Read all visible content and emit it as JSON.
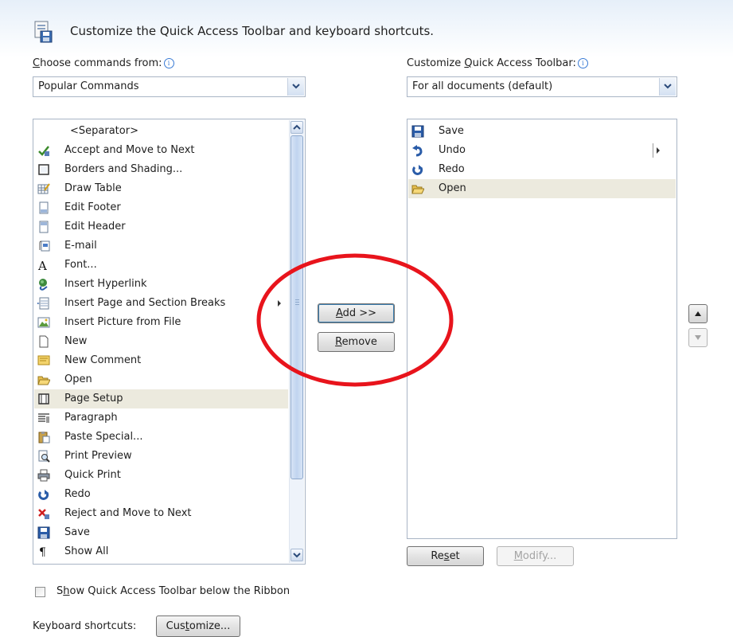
{
  "header": {
    "title": "Customize the Quick Access Toolbar and keyboard shortcuts."
  },
  "left": {
    "label_pre": "",
    "label_accel": "C",
    "label_post": "hoose commands from:",
    "dropdown_value": "Popular Commands",
    "items": [
      {
        "label": "<Separator>",
        "icon": "none"
      },
      {
        "label": "Accept and Move to Next",
        "icon": "accept-icon"
      },
      {
        "label": "Borders and Shading...",
        "icon": "borders-icon"
      },
      {
        "label": "Draw Table",
        "icon": "draw-table-icon"
      },
      {
        "label": "Edit Footer",
        "icon": "footer-icon"
      },
      {
        "label": "Edit Header",
        "icon": "header-icon"
      },
      {
        "label": "E-mail",
        "icon": "email-icon"
      },
      {
        "label": "Font...",
        "icon": "font-icon"
      },
      {
        "label": "Insert Hyperlink",
        "icon": "hyperlink-icon"
      },
      {
        "label": "Insert Page and Section Breaks",
        "icon": "page-break-icon"
      },
      {
        "label": "Insert Picture from File",
        "icon": "picture-icon"
      },
      {
        "label": "New",
        "icon": "new-document-icon"
      },
      {
        "label": "New Comment",
        "icon": "comment-icon"
      },
      {
        "label": "Open",
        "icon": "open-folder-icon"
      },
      {
        "label": "Page Setup",
        "icon": "page-setup-icon"
      },
      {
        "label": "Paragraph",
        "icon": "paragraph-icon"
      },
      {
        "label": "Paste Special...",
        "icon": "paste-icon"
      },
      {
        "label": "Print Preview",
        "icon": "print-preview-icon"
      },
      {
        "label": "Quick Print",
        "icon": "printer-icon"
      },
      {
        "label": "Redo",
        "icon": "redo-icon"
      },
      {
        "label": "Reject and Move to Next",
        "icon": "reject-icon"
      },
      {
        "label": "Save",
        "icon": "save-icon"
      },
      {
        "label": "Show All",
        "icon": "pilcrow-icon"
      }
    ]
  },
  "right": {
    "label_pre": "Customize ",
    "label_accel": "Q",
    "label_post": "uick Access Toolbar:",
    "dropdown_value": "For all documents (default)",
    "items": [
      {
        "label": "Save",
        "icon": "save-icon"
      },
      {
        "label": "Undo",
        "icon": "undo-icon"
      },
      {
        "label": "Redo",
        "icon": "redo-icon"
      },
      {
        "label": "Open",
        "icon": "open-folder-icon"
      }
    ]
  },
  "buttons": {
    "add_accel": "A",
    "add_rest": "dd >>",
    "remove_accel": "R",
    "remove_rest": "emove",
    "reset_pre": "Re",
    "reset_accel": "s",
    "reset_post": "et",
    "modify_accel": "M",
    "modify_rest": "odify...",
    "customize_pre": "Cus",
    "customize_accel": "t",
    "customize_post": "omize..."
  },
  "checkbox": {
    "pre": "S",
    "accel": "h",
    "post": "ow Quick Access Toolbar below the Ribbon",
    "checked": false
  },
  "shortcuts": {
    "label": "Keyboard shortcuts:"
  },
  "colors": {
    "annotation": "#e8141c",
    "selection": "#eceade"
  }
}
